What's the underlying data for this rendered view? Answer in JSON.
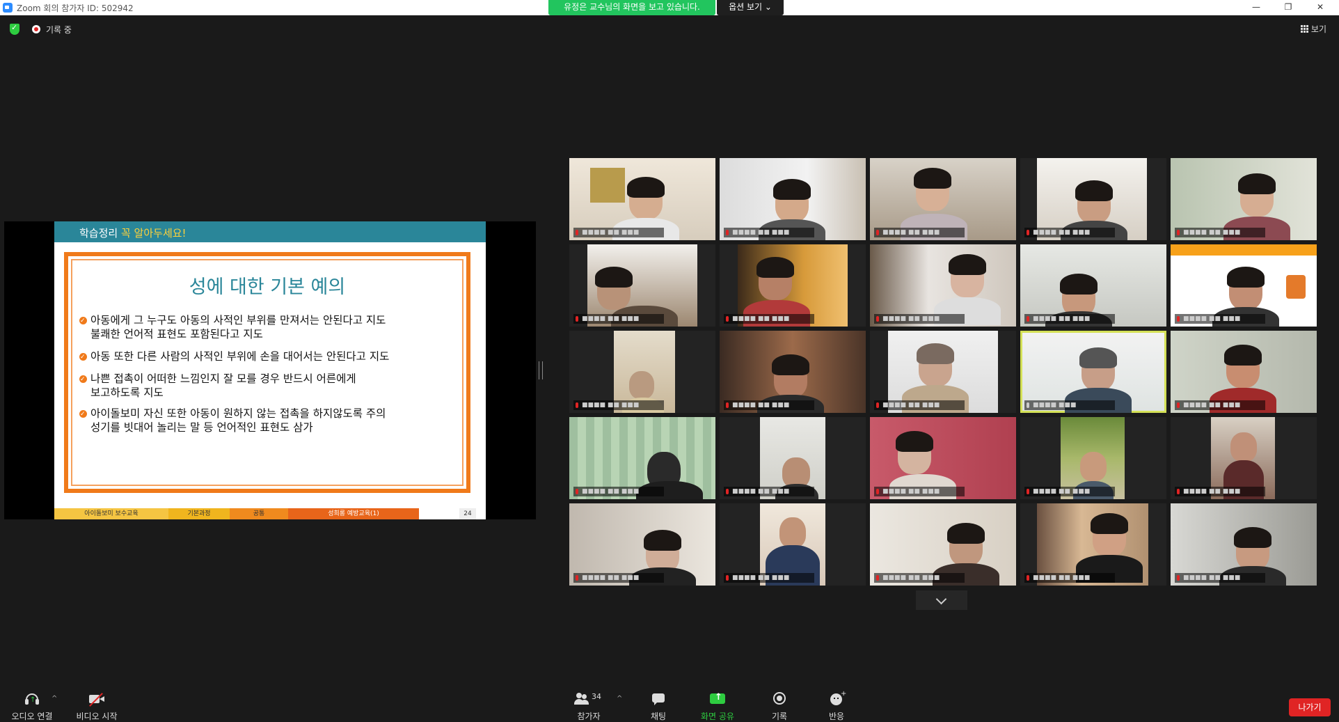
{
  "window": {
    "title": "Zoom 회의 참가자 ID: 502942",
    "minimize": "—",
    "restore": "❐",
    "close": "✕"
  },
  "banner": {
    "sharing_text": "유정은 교수님의 화면을 보고 있습니다.",
    "view_options": "옵션 보기 ⌄"
  },
  "status": {
    "recording_label": "기록 중",
    "view_label": "보기"
  },
  "slide": {
    "header_prefix": "학습정리",
    "header_highlight": "꼭 알아두세요!",
    "title": "성에 대한 기본 예의",
    "bullets": [
      {
        "line1": "아동에게 그 누구도 아동의 사적인 부위를 만져서는 안된다고 지도",
        "line2": "불쾌한 언어적 표현도 포함된다고 지도"
      },
      {
        "line1": "아동 또한 다른 사람의 사적인 부위에 손을 대어서는 안된다고 지도",
        "line2": ""
      },
      {
        "line1": "나쁜 접촉이 어떠한 느낌인지 잘 모를 경우 반드시 어른에게",
        "line2": "보고하도록 지도"
      },
      {
        "line1": "아이돌보미 자신 또한 아동이 원하지 않는 접촉을 하지않도록 주의",
        "line2": "성기를 빗대어 놀리는 말 등 언어적인 표현도 삼가"
      }
    ],
    "footer": [
      "아이돌보미 보수교육",
      "기본과정",
      "공통",
      "성희롱 예방교육(1)",
      "24"
    ]
  },
  "participants_count": "34",
  "toolbar": {
    "audio": "오디오 연결",
    "video": "비디오 시작",
    "participants": "참가자",
    "chat": "채팅",
    "share": "화면 공유",
    "record": "기록",
    "reactions": "반응",
    "leave": "나가기"
  },
  "colors": {
    "slide_teal": "#2a8699",
    "slide_orange": "#f07a1a",
    "share_green": "#22c55e",
    "leave_red": "#e02424",
    "active_speaker": "#d4e157"
  }
}
